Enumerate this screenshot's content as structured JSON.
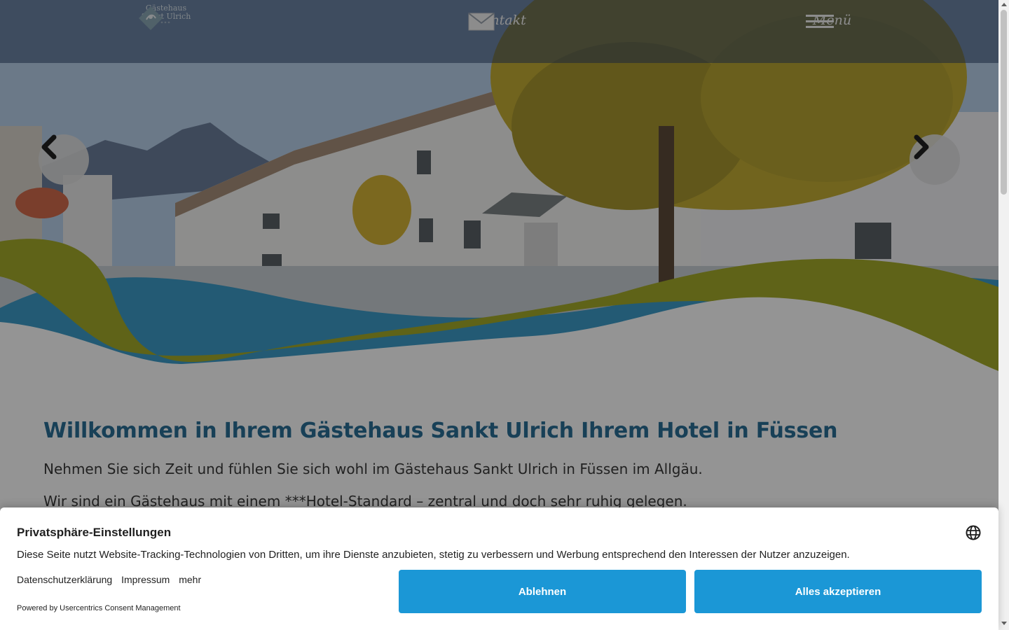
{
  "header": {
    "logo": {
      "line1": "Gästehaus",
      "line2": "Sankt Ulrich",
      "stars": "***"
    },
    "kontakt_label": "Kontakt",
    "menu_label": "Menü"
  },
  "hero": {
    "prev_icon": "chevron-left-icon",
    "next_icon": "chevron-right-icon"
  },
  "content": {
    "heading": "Willkommen in Ihrem Gästehaus Sankt Ulrich Ihrem Hotel in Füssen",
    "paragraphs": [
      "Nehmen Sie sich Zeit und fühlen Sie sich wohl im Gästehaus Sankt Ulrich in Füssen im Allgäu.",
      "Wir sind ein Gästehaus mit einem ***Hotel-Standard – zentral und doch sehr ruhig gelegen."
    ]
  },
  "consent": {
    "title": "Privatsphäre-Einstellungen",
    "text": "Diese Seite nutzt Website-Tracking-Technologien von Dritten, um ihre Dienste anzubieten, stetig zu verbessern und Werbung entsprechend den Interessen der Nutzer anzuzeigen.",
    "links": [
      "Datenschutzerklärung",
      "Impressum",
      "mehr"
    ],
    "powered_by": "Powered by Usercentrics Consent Management",
    "deny_label": "Ablehnen",
    "accept_label": "Alles akzeptieren",
    "language_icon": "globe-icon"
  },
  "colors": {
    "heading": "#2a6f97",
    "button": "#1b97d6",
    "wave_green": "#a4ab2a",
    "wave_blue": "#3d9cc9"
  }
}
